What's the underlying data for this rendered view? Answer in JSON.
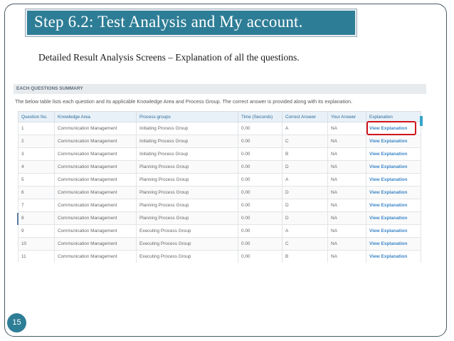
{
  "slide": {
    "title": "Step 6.2: Test Analysis and My account.",
    "subtitle": "Detailed Result Analysis Screens – Explanation of all the questions.",
    "page_number": "15",
    "accent_color": "#2e7d96"
  },
  "summary": {
    "header": "EACH QUESTIONS SUMMARY",
    "description": "The below table lists each question and its applicable Knowledge Area and Process Group. The correct answer is provided along with its explanation."
  },
  "table": {
    "columns": [
      "Question No.",
      "Knowledge Area",
      "Process groups",
      "Time (Seconds)",
      "Correct Answer",
      "Your Answer",
      "Explanation"
    ],
    "rows": [
      [
        "1",
        "Communication Management",
        "Initiating Process Group",
        "0.00",
        "A",
        "NA",
        "View Explanation"
      ],
      [
        "2",
        "Communication Management",
        "Initiating Process Group",
        "0.00",
        "C",
        "NA",
        "View Explanation"
      ],
      [
        "3",
        "Communication Management",
        "Initiating Process Group",
        "0.00",
        "B",
        "NA",
        "View Explanation"
      ],
      [
        "4",
        "Communication Management",
        "Planning Process Group",
        "0.00",
        "D",
        "NA",
        "View Explanation"
      ],
      [
        "5",
        "Communication Management",
        "Planning Process Group",
        "0.00",
        "A",
        "NA",
        "View Explanation"
      ],
      [
        "6",
        "Communication Management",
        "Planning Process Group",
        "0.00",
        "D",
        "NA",
        "View Explanation"
      ],
      [
        "7",
        "Communication Management",
        "Planning Process Group",
        "0.00",
        "D",
        "NA",
        "View Explanation"
      ],
      [
        "8",
        "Communication Management",
        "Planning Process Group",
        "0.00",
        "D",
        "NA",
        "View Explanation"
      ],
      [
        "9",
        "Communication Management",
        "Executing Process Group",
        "0.00",
        "A",
        "NA",
        "View Explanation"
      ],
      [
        "10",
        "Communication Management",
        "Executing Process Group",
        "0.00",
        "C",
        "NA",
        "View Explanation"
      ],
      [
        "11",
        "Communication Management",
        "Executing Process Group",
        "0.00",
        "B",
        "NA",
        "View Explanation"
      ]
    ]
  }
}
